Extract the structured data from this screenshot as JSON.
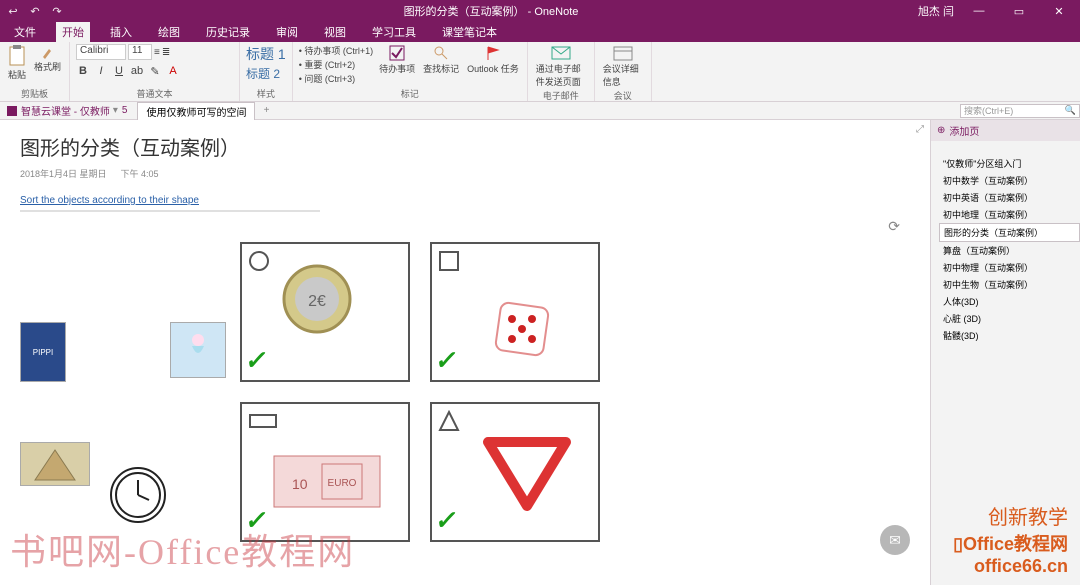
{
  "titlebar": {
    "doc_title": "图形的分类（互动案例） - OneNote",
    "user": "旭杰 闫",
    "min": "—",
    "restore": "▭",
    "close": "✕"
  },
  "menu": {
    "file": "文件",
    "home": "开始",
    "insert": "插入",
    "draw": "绘图",
    "history": "历史记录",
    "review": "审阅",
    "view": "视图",
    "learn": "学习工具",
    "class": "课堂笔记本"
  },
  "ribbon": {
    "clipboard": {
      "paste": "粘贴",
      "format_painter": "格式刷",
      "label": "剪贴板"
    },
    "font": {
      "name": "Calibri",
      "size": "11",
      "label": "普通文本"
    },
    "styles": {
      "h1": "标题 1",
      "h2": "标题 2",
      "label": "样式"
    },
    "tags": {
      "todo": "待办事项 (Ctrl+1)",
      "important": "重要 (Ctrl+2)",
      "question": "问题 (Ctrl+3)",
      "todo_btn": "待办事项",
      "find_tags": "查找标记",
      "outlook": "Outlook 任务",
      "label": "标记"
    },
    "email": {
      "btn": "通过电子邮件发送页面",
      "label": "电子邮件"
    },
    "meetings": {
      "btn": "会议详细信息",
      "label": "会议"
    }
  },
  "notebook": {
    "name": "智慧云课堂 - 仅教师",
    "count": "5",
    "page_tab": "使用仅教师可写的空间",
    "search_placeholder": "搜索(Ctrl+E)"
  },
  "page": {
    "title": "图形的分类（互动案例）",
    "date": "2018年1月4日 星期日",
    "time": "下午 4:05",
    "link": "Sort the objects according to their shape"
  },
  "sidebar": {
    "add_page": "添加页",
    "items": [
      "\"仅教师\"分区组入门",
      "初中数学（互动案例）",
      "初中英语（互动案例）",
      "初中地理（互动案例）",
      "图形的分类（互动案例）",
      "算盘（互动案例）",
      "初中物理（互动案例）",
      "初中生物（互动案例）",
      "人体(3D)",
      "心脏 (3D)",
      "骷髅(3D)"
    ],
    "selected_index": 4
  },
  "watermark": {
    "left": "书吧网-Office教程网",
    "right_top": "创新教学",
    "right_brand": "Office教程网",
    "right_url": "office66.cn"
  }
}
